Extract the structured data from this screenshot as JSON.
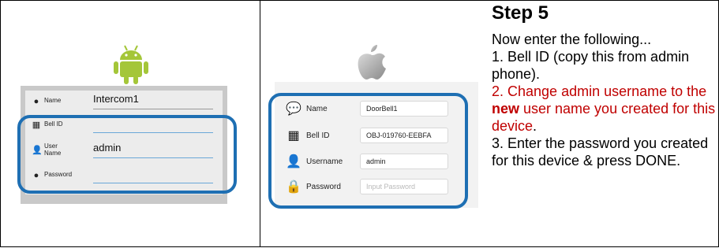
{
  "android_form": {
    "fields": [
      {
        "label": "Name",
        "value": "Intercom1",
        "icon": "chat-bubble-icon"
      },
      {
        "label": "Bell ID",
        "value": "",
        "icon": "grid-icon"
      },
      {
        "label_line1": "User",
        "label_line2": "Name",
        "value": "admin",
        "icon": "person-icon"
      },
      {
        "label": "Password",
        "value": "",
        "icon": "lock-icon"
      }
    ]
  },
  "ios_form": {
    "fields": [
      {
        "label": "Name",
        "value": "DoorBell1",
        "icon": "chat-bubble-icon"
      },
      {
        "label": "Bell ID",
        "value": "OBJ-019760-EEBFA",
        "icon": "grid-icon"
      },
      {
        "label": "Username",
        "value": "admin",
        "icon": "person-icon"
      },
      {
        "label": "Password",
        "placeholder": "Input Password",
        "icon": "lock-icon"
      }
    ]
  },
  "instructions": {
    "title": "Step 5",
    "intro": "Now enter the following...",
    "item1": "1. Bell ID (copy this from admin phone).",
    "item2_part1": "2. Change admin username to the ",
    "item2_bold": "new",
    "item2_part2": " user name you created for this device",
    "item2_end": ".",
    "item3": "3. Enter the password you created for this device & press DONE."
  },
  "colors": {
    "accent_blue": "#1e6fb3",
    "android_green": "#a4c639",
    "warning_red": "#c00000"
  }
}
